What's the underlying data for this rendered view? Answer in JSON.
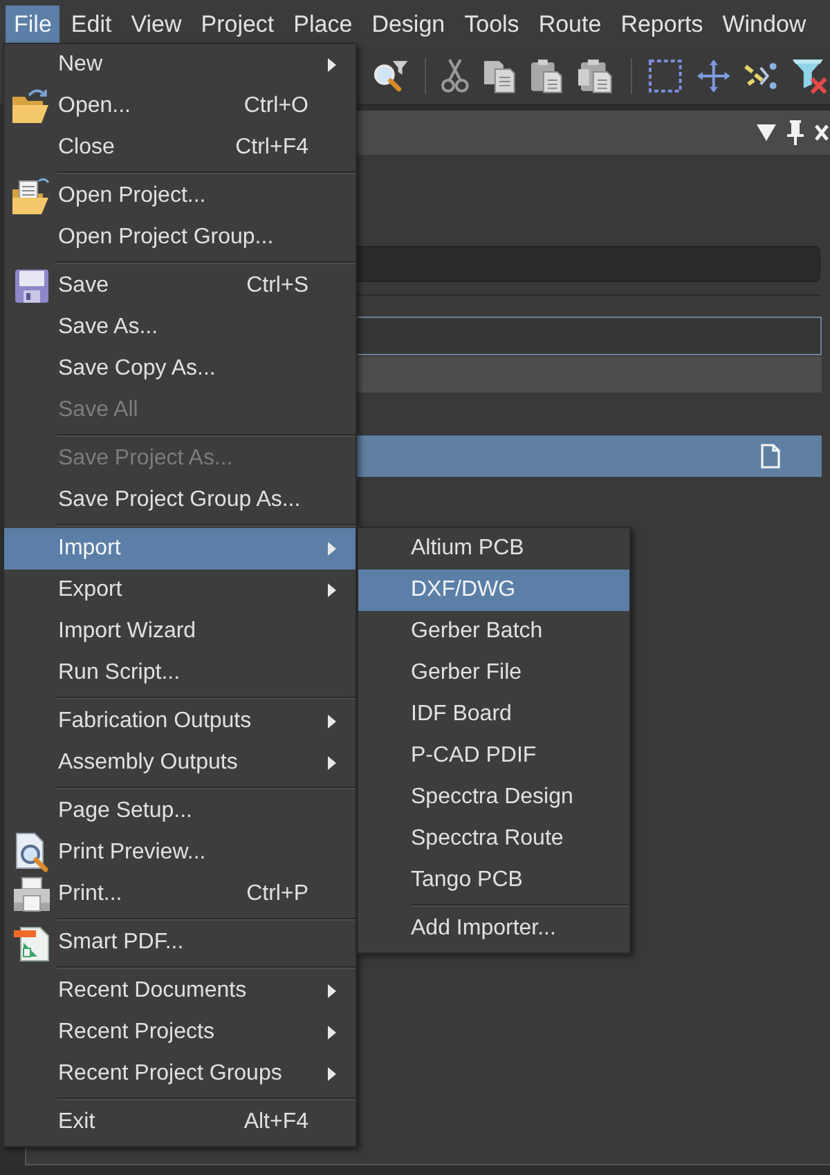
{
  "menu_bar": [
    {
      "label": "File",
      "selected": true
    },
    {
      "label": "Edit",
      "selected": false
    },
    {
      "label": "View",
      "selected": false
    },
    {
      "label": "Project",
      "selected": false
    },
    {
      "label": "Place",
      "selected": false
    },
    {
      "label": "Design",
      "selected": false
    },
    {
      "label": "Tools",
      "selected": false
    },
    {
      "label": "Route",
      "selected": false
    },
    {
      "label": "Reports",
      "selected": false
    },
    {
      "label": "Window",
      "selected": false
    }
  ],
  "file_menu": {
    "sections": [
      [
        {
          "label": "New",
          "has_submenu": true,
          "disabled": false,
          "selected": false
        },
        {
          "label": "Open...",
          "shortcut": "Ctrl+O",
          "has_submenu": false,
          "disabled": false,
          "selected": false
        },
        {
          "label": "Close",
          "shortcut": "Ctrl+F4",
          "has_submenu": false,
          "disabled": false,
          "selected": false
        }
      ],
      [
        {
          "label": "Open Project...",
          "has_submenu": false,
          "disabled": false,
          "selected": false
        },
        {
          "label": "Open Project Group...",
          "has_submenu": false,
          "disabled": false,
          "selected": false
        }
      ],
      [
        {
          "label": "Save",
          "shortcut": "Ctrl+S",
          "has_submenu": false,
          "disabled": false,
          "selected": false
        },
        {
          "label": "Save As...",
          "has_submenu": false,
          "disabled": false,
          "selected": false
        },
        {
          "label": "Save Copy As...",
          "has_submenu": false,
          "disabled": false,
          "selected": false
        },
        {
          "label": "Save All",
          "has_submenu": false,
          "disabled": true,
          "selected": false
        }
      ],
      [
        {
          "label": "Save Project As...",
          "has_submenu": false,
          "disabled": true,
          "selected": false
        },
        {
          "label": "Save Project Group As...",
          "has_submenu": false,
          "disabled": false,
          "selected": false
        }
      ],
      [
        {
          "label": "Import",
          "has_submenu": true,
          "disabled": false,
          "selected": true
        },
        {
          "label": "Export",
          "has_submenu": true,
          "disabled": false,
          "selected": false
        },
        {
          "label": "Import Wizard",
          "has_submenu": false,
          "disabled": false,
          "selected": false
        },
        {
          "label": "Run Script...",
          "has_submenu": false,
          "disabled": false,
          "selected": false
        }
      ],
      [
        {
          "label": "Fabrication Outputs",
          "has_submenu": true,
          "disabled": false,
          "selected": false
        },
        {
          "label": "Assembly Outputs",
          "has_submenu": true,
          "disabled": false,
          "selected": false
        }
      ],
      [
        {
          "label": "Page Setup...",
          "has_submenu": false,
          "disabled": false,
          "selected": false
        },
        {
          "label": "Print Preview...",
          "has_submenu": false,
          "disabled": false,
          "selected": false
        },
        {
          "label": "Print...",
          "shortcut": "Ctrl+P",
          "has_submenu": false,
          "disabled": false,
          "selected": false
        }
      ],
      [
        {
          "label": "Smart PDF...",
          "has_submenu": false,
          "disabled": false,
          "selected": false
        }
      ],
      [
        {
          "label": "Recent Documents",
          "has_submenu": true,
          "disabled": false,
          "selected": false
        },
        {
          "label": "Recent Projects",
          "has_submenu": true,
          "disabled": false,
          "selected": false
        },
        {
          "label": "Recent Project Groups",
          "has_submenu": true,
          "disabled": false,
          "selected": false
        }
      ],
      [
        {
          "label": "Exit",
          "shortcut": "Alt+F4",
          "has_submenu": false,
          "disabled": false,
          "selected": false
        }
      ]
    ]
  },
  "import_submenu": {
    "sections": [
      [
        {
          "label": "Altium PCB",
          "selected": false
        },
        {
          "label": "DXF/DWG",
          "selected": true
        },
        {
          "label": "Gerber Batch",
          "selected": false
        },
        {
          "label": "Gerber File",
          "selected": false
        },
        {
          "label": "IDF Board",
          "selected": false
        },
        {
          "label": "P-CAD PDIF",
          "selected": false
        },
        {
          "label": "Specctra Design",
          "selected": false
        },
        {
          "label": "Specctra Route",
          "selected": false
        },
        {
          "label": "Tango PCB",
          "selected": false
        }
      ],
      [
        {
          "label": "Add Importer...",
          "selected": false
        }
      ]
    ]
  },
  "panel": {
    "rows": [
      {
        "kind": "group",
        "selected": false
      },
      {
        "kind": "file",
        "selected": true
      }
    ]
  }
}
